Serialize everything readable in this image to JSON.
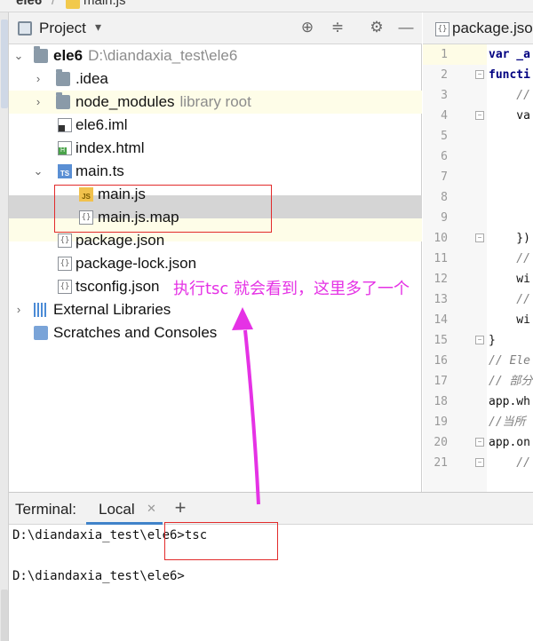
{
  "breadcrumb": {
    "project": "ele6",
    "separator": "/",
    "file": "main.js"
  },
  "project_panel": {
    "title": "Project",
    "dropdown_icon": "chevron-down-icon",
    "toolbar_icons": [
      "locate-icon",
      "collapse-icon",
      "gear-icon",
      "minimize-icon"
    ],
    "root": {
      "name": "ele6",
      "path": "D:\\diandaxia_test\\ele6"
    },
    "items": [
      {
        "label": ".idea",
        "hint": "",
        "icon": "folder-icon"
      },
      {
        "label": "node_modules",
        "hint": "library root",
        "icon": "folder-icon"
      },
      {
        "label": "ele6.iml",
        "hint": "",
        "icon": "iml-file-icon"
      },
      {
        "label": "index.html",
        "hint": "",
        "icon": "html-file-icon"
      },
      {
        "label": "main.ts",
        "hint": "",
        "icon": "ts-file-icon"
      },
      {
        "label": "main.js",
        "hint": "",
        "icon": "js-file-icon"
      },
      {
        "label": "main.js.map",
        "hint": "",
        "icon": "map-file-icon"
      },
      {
        "label": "package.json",
        "hint": "",
        "icon": "json-file-icon"
      },
      {
        "label": "package-lock.json",
        "hint": "",
        "icon": "json-file-icon"
      },
      {
        "label": "tsconfig.json",
        "hint": "",
        "icon": "json-file-icon"
      }
    ],
    "external_libraries": "External Libraries",
    "scratches": "Scratches and Consoles"
  },
  "editor": {
    "tab_label": "package.json",
    "line_numbers": [
      "1",
      "2",
      "3",
      "4",
      "5",
      "6",
      "7",
      "8",
      "9",
      "10",
      "11",
      "12",
      "13",
      "14",
      "15",
      "16",
      "17",
      "18",
      "19",
      "20",
      "21"
    ],
    "code_lines": [
      "var _a",
      "functi",
      "    //",
      "    va",
      "",
      "",
      "",
      "",
      "",
      "    })",
      "    //",
      "    wi",
      "    //",
      "    wi",
      "}",
      "// Ele",
      "// 部分",
      "app.wh",
      "//当所",
      "app.on",
      "    //"
    ]
  },
  "terminal": {
    "title": "Terminal:",
    "tab_local": "Local",
    "close_icon": "close-icon",
    "add_icon": "plus-icon",
    "lines": [
      "D:\\diandaxia_test\\ele6>tsc",
      "",
      "D:\\diandaxia_test\\ele6>"
    ]
  },
  "annotation": {
    "text": "执行tsc 就会看到，这里多了一个",
    "color": "#e532e5",
    "box_color": "#e22b2b"
  }
}
